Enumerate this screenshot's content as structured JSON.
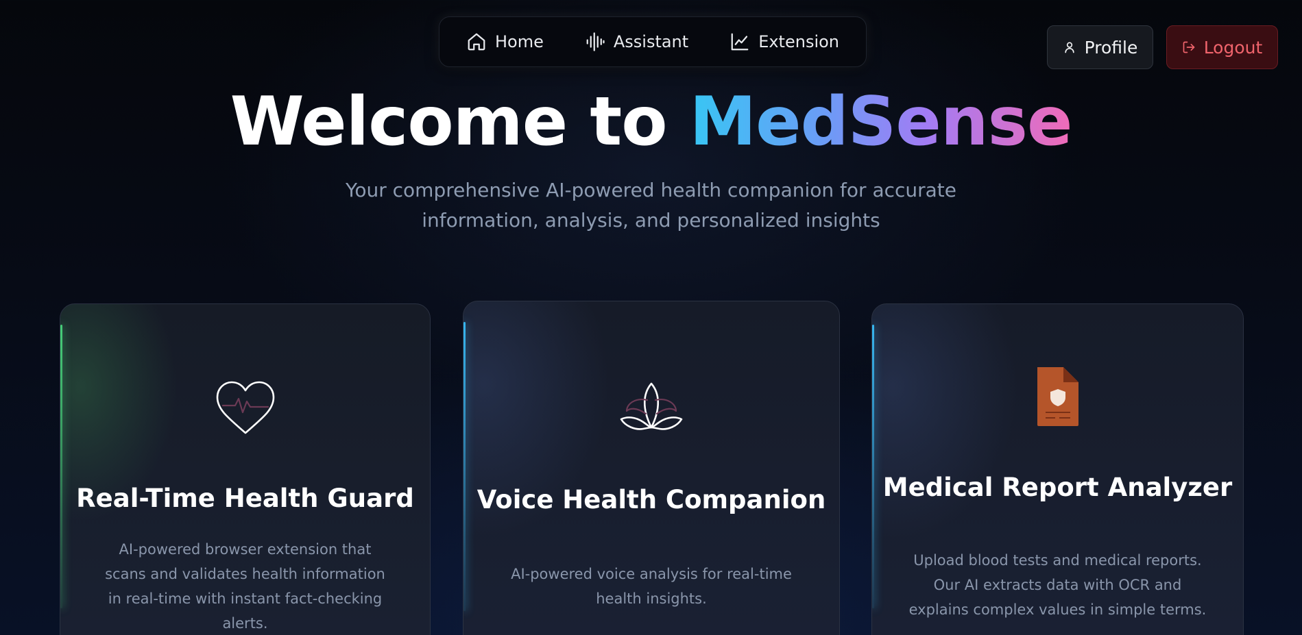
{
  "nav": {
    "items": [
      {
        "label": "Home",
        "icon": "home-icon"
      },
      {
        "label": "Assistant",
        "icon": "audio-waveform-icon"
      },
      {
        "label": "Extension",
        "icon": "line-chart-icon"
      }
    ]
  },
  "header": {
    "profile_label": "Profile",
    "logout_label": "Logout"
  },
  "hero": {
    "title_prefix": "Welcome to ",
    "title_brand": "MedSense",
    "subtitle": "Your comprehensive AI-powered health companion for accurate information, analysis, and personalized insights"
  },
  "features": [
    {
      "title": "Real-Time Health Guard",
      "description": "AI-powered browser extension that scans and validates health information in real-time with instant fact-checking alerts.",
      "icon": "heart-pulse-icon",
      "accent": "#4ade80"
    },
    {
      "title": "Voice Health Companion",
      "description": "AI-powered voice analysis for real-time health insights.",
      "icon": "lotus-icon",
      "accent": "#38bdf8"
    },
    {
      "title": "Medical Report Analyzer",
      "description": "Upload blood tests and medical reports. Our AI extracts data with OCR and explains complex values in simple terms.",
      "icon": "medical-document-icon",
      "accent": "#38bdf8"
    }
  ],
  "colors": {
    "brand_gradient": [
      "#38c6f4",
      "#6b9cf6",
      "#a27cf4",
      "#f06bb8"
    ],
    "logout": "#f0646c",
    "document_icon": "#b5552a"
  }
}
